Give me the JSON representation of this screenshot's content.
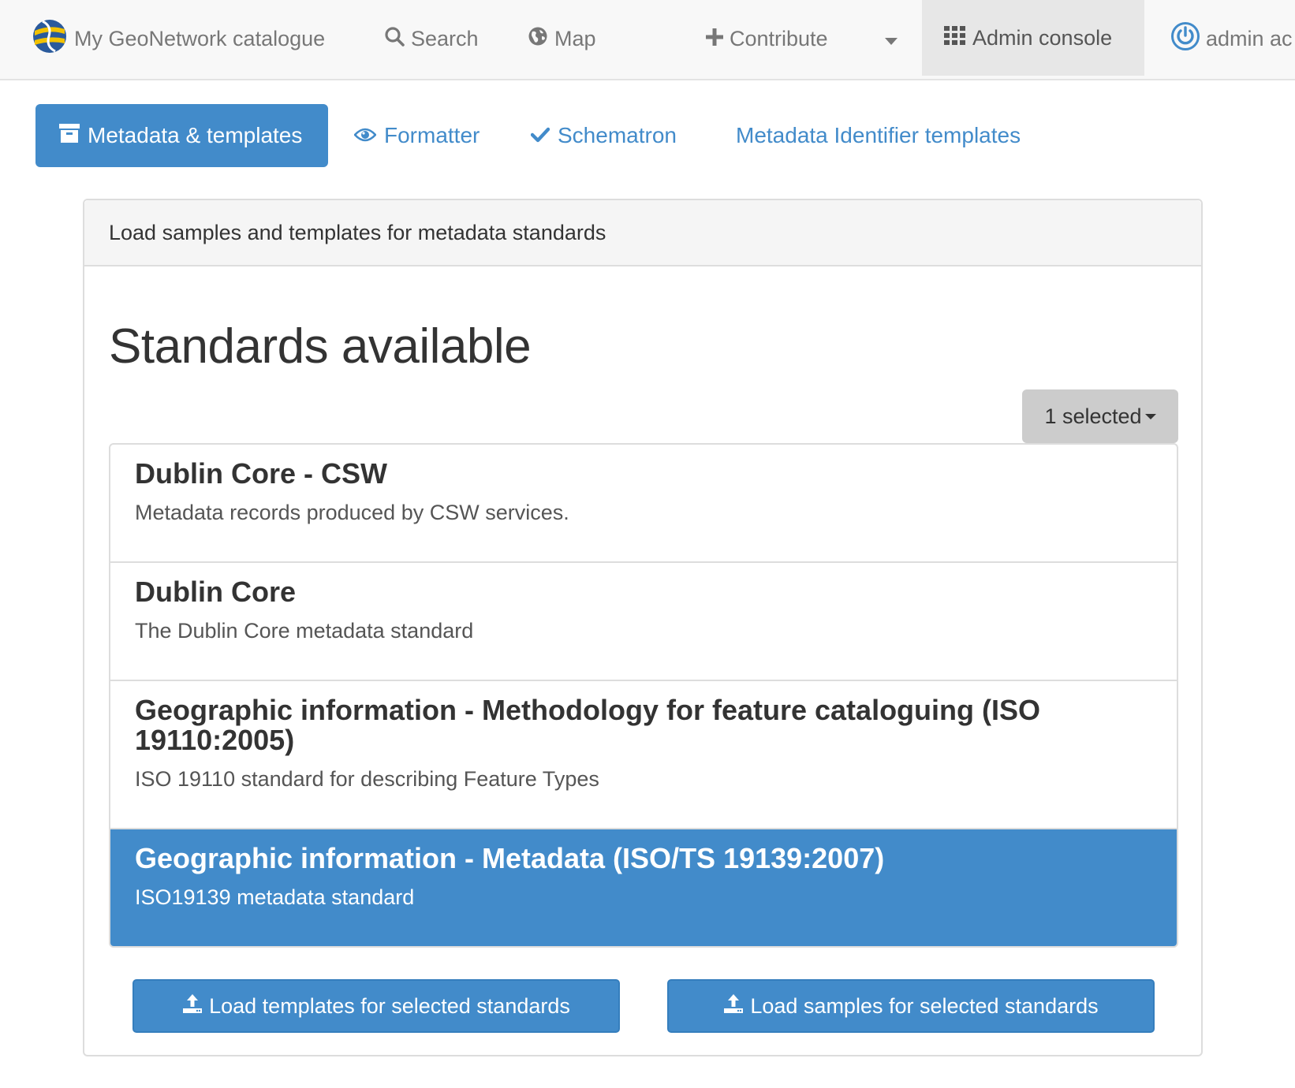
{
  "navbar": {
    "brand_label": "My GeoNetwork catalogue",
    "search_label": "Search",
    "map_label": "Map",
    "contribute_label": "Contribute",
    "admin_label": "Admin console",
    "user_label": "admin ac",
    "link_color": "#777777",
    "active_bg": "#e7e7e7"
  },
  "tabs": [
    {
      "label": "Metadata & templates",
      "icon": "archive-icon",
      "active": true
    },
    {
      "label": "Formatter",
      "icon": "eye-icon",
      "active": false
    },
    {
      "label": "Schematron",
      "icon": "checkmark-icon",
      "active": false
    },
    {
      "label": "Metadata Identifier templates",
      "icon": "",
      "active": false
    }
  ],
  "panel": {
    "heading": "Load samples and templates for metadata standards",
    "title": "Standards available",
    "selection_label": "1 selected",
    "standards": [
      {
        "title": "Dublin Core - CSW",
        "description": "Metadata records produced by CSW services.",
        "selected": false
      },
      {
        "title": "Dublin Core",
        "description": "The Dublin Core metadata standard",
        "selected": false
      },
      {
        "title": "Geographic information - Methodology for feature cataloguing (ISO 19110:2005)",
        "description": "ISO 19110 standard for describing Feature Types",
        "selected": false
      },
      {
        "title": "Geographic information - Metadata (ISO/TS 19139:2007)",
        "description": "ISO19139 metadata standard",
        "selected": true
      }
    ],
    "load_templates_label": "Load templates for selected standards",
    "load_samples_label": "Load samples for selected standards"
  },
  "colors": {
    "primary": "#428bca",
    "selected_row": "#428bca",
    "dropdown_bg": "#cccccc"
  }
}
